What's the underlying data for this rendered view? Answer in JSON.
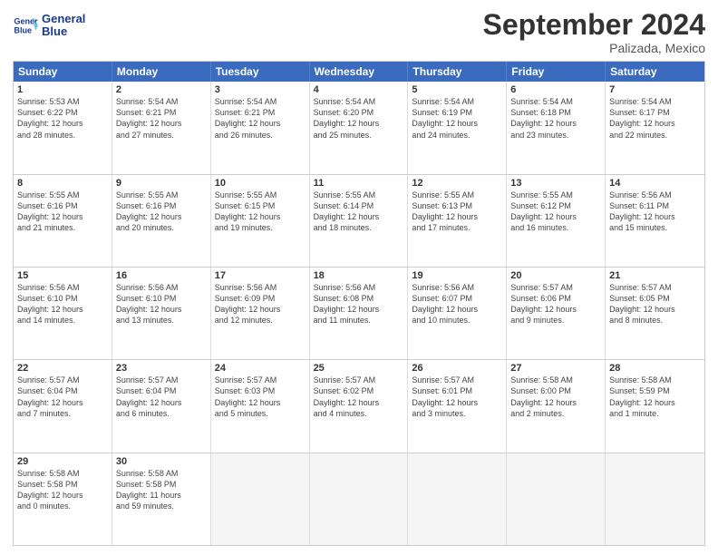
{
  "logo": {
    "line1": "General",
    "line2": "Blue"
  },
  "title": "September 2024",
  "subtitle": "Palizada, Mexico",
  "days": [
    "Sunday",
    "Monday",
    "Tuesday",
    "Wednesday",
    "Thursday",
    "Friday",
    "Saturday"
  ],
  "rows": [
    [
      {
        "day": "1",
        "lines": [
          "Sunrise: 5:53 AM",
          "Sunset: 6:22 PM",
          "Daylight: 12 hours",
          "and 28 minutes."
        ]
      },
      {
        "day": "2",
        "lines": [
          "Sunrise: 5:54 AM",
          "Sunset: 6:21 PM",
          "Daylight: 12 hours",
          "and 27 minutes."
        ]
      },
      {
        "day": "3",
        "lines": [
          "Sunrise: 5:54 AM",
          "Sunset: 6:21 PM",
          "Daylight: 12 hours",
          "and 26 minutes."
        ]
      },
      {
        "day": "4",
        "lines": [
          "Sunrise: 5:54 AM",
          "Sunset: 6:20 PM",
          "Daylight: 12 hours",
          "and 25 minutes."
        ]
      },
      {
        "day": "5",
        "lines": [
          "Sunrise: 5:54 AM",
          "Sunset: 6:19 PM",
          "Daylight: 12 hours",
          "and 24 minutes."
        ]
      },
      {
        "day": "6",
        "lines": [
          "Sunrise: 5:54 AM",
          "Sunset: 6:18 PM",
          "Daylight: 12 hours",
          "and 23 minutes."
        ]
      },
      {
        "day": "7",
        "lines": [
          "Sunrise: 5:54 AM",
          "Sunset: 6:17 PM",
          "Daylight: 12 hours",
          "and 22 minutes."
        ]
      }
    ],
    [
      {
        "day": "8",
        "lines": [
          "Sunrise: 5:55 AM",
          "Sunset: 6:16 PM",
          "Daylight: 12 hours",
          "and 21 minutes."
        ]
      },
      {
        "day": "9",
        "lines": [
          "Sunrise: 5:55 AM",
          "Sunset: 6:16 PM",
          "Daylight: 12 hours",
          "and 20 minutes."
        ]
      },
      {
        "day": "10",
        "lines": [
          "Sunrise: 5:55 AM",
          "Sunset: 6:15 PM",
          "Daylight: 12 hours",
          "and 19 minutes."
        ]
      },
      {
        "day": "11",
        "lines": [
          "Sunrise: 5:55 AM",
          "Sunset: 6:14 PM",
          "Daylight: 12 hours",
          "and 18 minutes."
        ]
      },
      {
        "day": "12",
        "lines": [
          "Sunrise: 5:55 AM",
          "Sunset: 6:13 PM",
          "Daylight: 12 hours",
          "and 17 minutes."
        ]
      },
      {
        "day": "13",
        "lines": [
          "Sunrise: 5:55 AM",
          "Sunset: 6:12 PM",
          "Daylight: 12 hours",
          "and 16 minutes."
        ]
      },
      {
        "day": "14",
        "lines": [
          "Sunrise: 5:56 AM",
          "Sunset: 6:11 PM",
          "Daylight: 12 hours",
          "and 15 minutes."
        ]
      }
    ],
    [
      {
        "day": "15",
        "lines": [
          "Sunrise: 5:56 AM",
          "Sunset: 6:10 PM",
          "Daylight: 12 hours",
          "and 14 minutes."
        ]
      },
      {
        "day": "16",
        "lines": [
          "Sunrise: 5:56 AM",
          "Sunset: 6:10 PM",
          "Daylight: 12 hours",
          "and 13 minutes."
        ]
      },
      {
        "day": "17",
        "lines": [
          "Sunrise: 5:56 AM",
          "Sunset: 6:09 PM",
          "Daylight: 12 hours",
          "and 12 minutes."
        ]
      },
      {
        "day": "18",
        "lines": [
          "Sunrise: 5:56 AM",
          "Sunset: 6:08 PM",
          "Daylight: 12 hours",
          "and 11 minutes."
        ]
      },
      {
        "day": "19",
        "lines": [
          "Sunrise: 5:56 AM",
          "Sunset: 6:07 PM",
          "Daylight: 12 hours",
          "and 10 minutes."
        ]
      },
      {
        "day": "20",
        "lines": [
          "Sunrise: 5:57 AM",
          "Sunset: 6:06 PM",
          "Daylight: 12 hours",
          "and 9 minutes."
        ]
      },
      {
        "day": "21",
        "lines": [
          "Sunrise: 5:57 AM",
          "Sunset: 6:05 PM",
          "Daylight: 12 hours",
          "and 8 minutes."
        ]
      }
    ],
    [
      {
        "day": "22",
        "lines": [
          "Sunrise: 5:57 AM",
          "Sunset: 6:04 PM",
          "Daylight: 12 hours",
          "and 7 minutes."
        ]
      },
      {
        "day": "23",
        "lines": [
          "Sunrise: 5:57 AM",
          "Sunset: 6:04 PM",
          "Daylight: 12 hours",
          "and 6 minutes."
        ]
      },
      {
        "day": "24",
        "lines": [
          "Sunrise: 5:57 AM",
          "Sunset: 6:03 PM",
          "Daylight: 12 hours",
          "and 5 minutes."
        ]
      },
      {
        "day": "25",
        "lines": [
          "Sunrise: 5:57 AM",
          "Sunset: 6:02 PM",
          "Daylight: 12 hours",
          "and 4 minutes."
        ]
      },
      {
        "day": "26",
        "lines": [
          "Sunrise: 5:57 AM",
          "Sunset: 6:01 PM",
          "Daylight: 12 hours",
          "and 3 minutes."
        ]
      },
      {
        "day": "27",
        "lines": [
          "Sunrise: 5:58 AM",
          "Sunset: 6:00 PM",
          "Daylight: 12 hours",
          "and 2 minutes."
        ]
      },
      {
        "day": "28",
        "lines": [
          "Sunrise: 5:58 AM",
          "Sunset: 5:59 PM",
          "Daylight: 12 hours",
          "and 1 minute."
        ]
      }
    ],
    [
      {
        "day": "29",
        "lines": [
          "Sunrise: 5:58 AM",
          "Sunset: 5:58 PM",
          "Daylight: 12 hours",
          "and 0 minutes."
        ]
      },
      {
        "day": "30",
        "lines": [
          "Sunrise: 5:58 AM",
          "Sunset: 5:58 PM",
          "Daylight: 11 hours",
          "and 59 minutes."
        ]
      },
      {
        "day": "",
        "lines": []
      },
      {
        "day": "",
        "lines": []
      },
      {
        "day": "",
        "lines": []
      },
      {
        "day": "",
        "lines": []
      },
      {
        "day": "",
        "lines": []
      }
    ]
  ]
}
